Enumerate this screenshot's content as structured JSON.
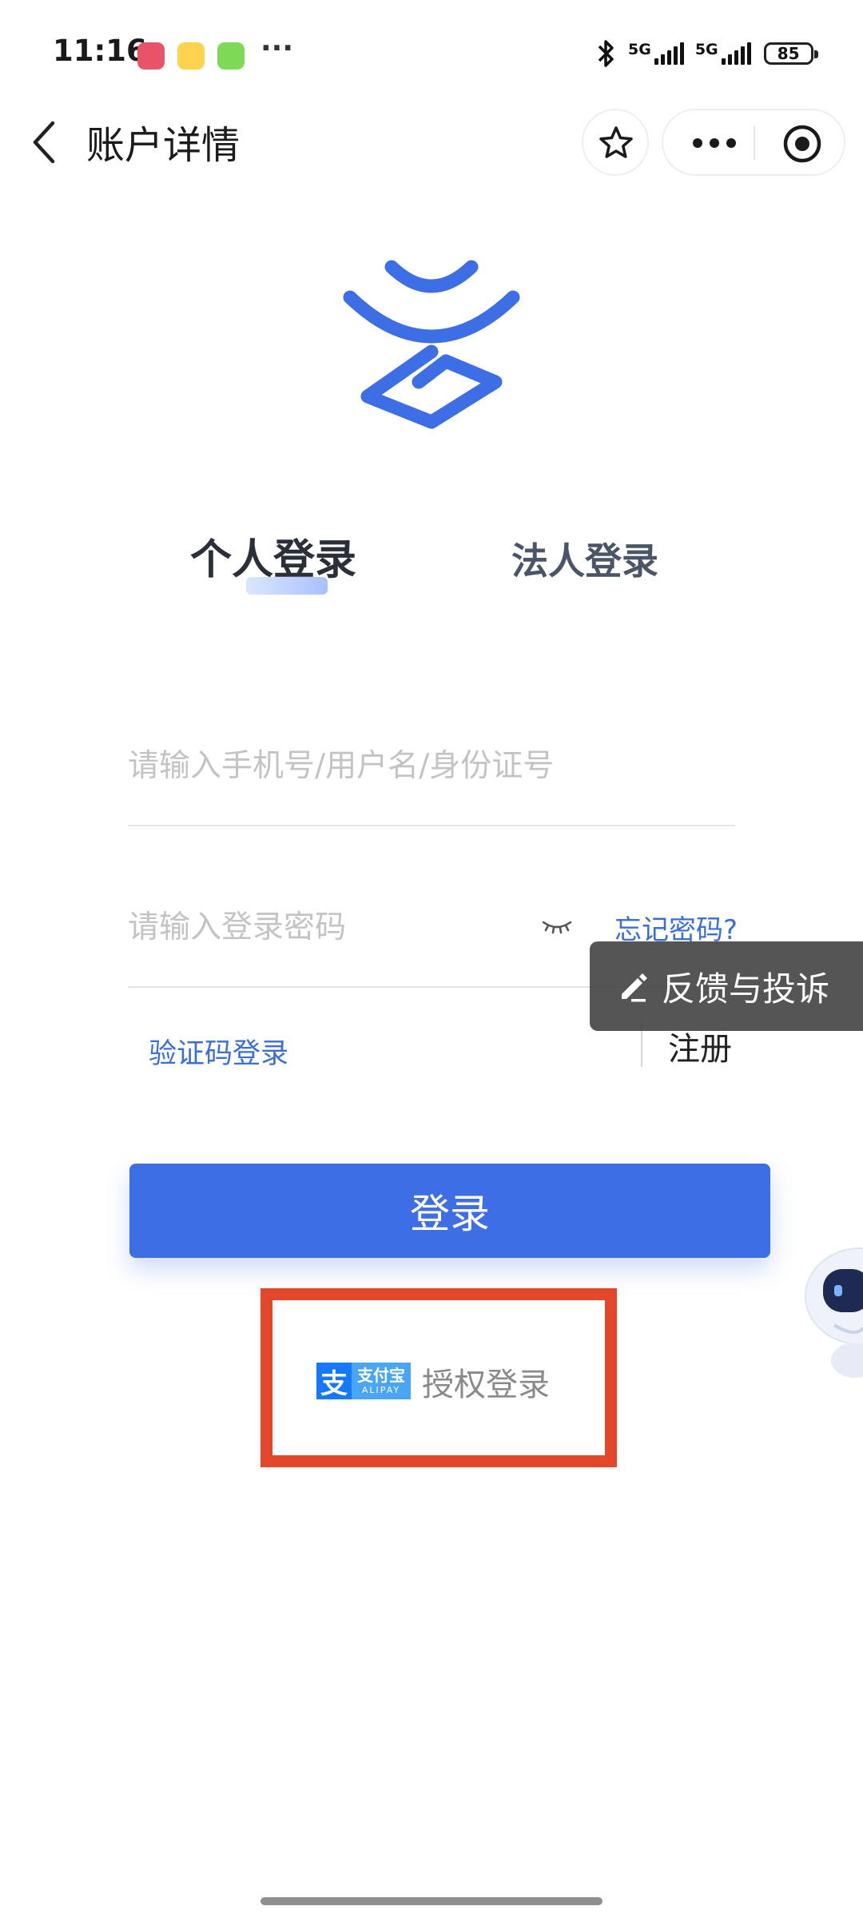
{
  "status_bar": {
    "time": "11:16",
    "ellipsis": "···",
    "network_1": "5G",
    "network_2": "5G",
    "battery": "85",
    "icons": [
      "app-icon-red",
      "app-icon-flower",
      "app-icon-green-calendar",
      "bluetooth-icon",
      "signal-icon",
      "battery-icon"
    ]
  },
  "nav": {
    "title": "账户详情",
    "icons": [
      "back-arrow-icon",
      "star-icon",
      "more-dots-icon",
      "target-icon"
    ]
  },
  "brand": {
    "logo_icon": "brand-logo-icon",
    "color": "#3e6ee6"
  },
  "tabs": [
    {
      "label": "个人登录",
      "active": true
    },
    {
      "label": "法人登录",
      "active": false
    }
  ],
  "form": {
    "username_placeholder": "请输入手机号/用户名/身份证号",
    "password_placeholder": "请输入登录密码",
    "forgot_password": "忘记密码?",
    "sms_login": "验证码登录",
    "register": "注册"
  },
  "feedback": {
    "label": "反馈与投诉",
    "icon": "edit-pen-icon"
  },
  "login_button": {
    "label": "登录",
    "color": "#3e6ee6"
  },
  "alipay": {
    "logo_glyph": "支",
    "logo_cn": "支付宝",
    "logo_en": "ALIPAY",
    "label": "授权登录",
    "highlight_color": "#e2472b"
  },
  "assistant": {
    "icon": "robot-assistant-icon"
  }
}
